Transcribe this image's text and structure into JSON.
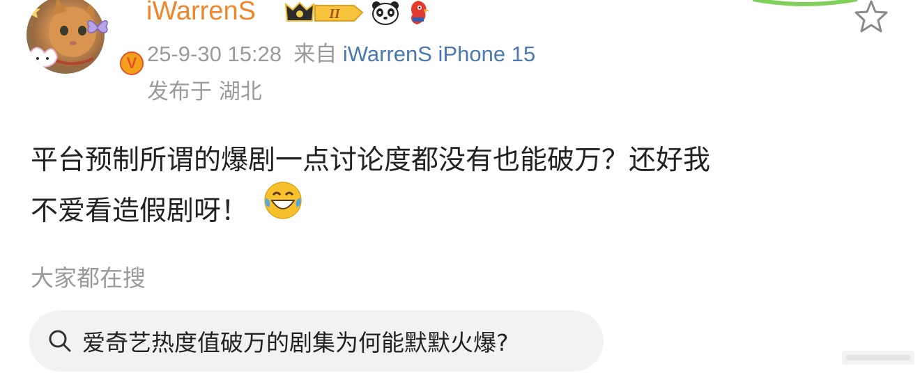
{
  "post": {
    "username": "iWarrenS",
    "timestamp": "25-9-30 15:28",
    "source_prefix": "来自",
    "source": "iWarrenS iPhone 15",
    "location": "发布于 湖北",
    "text_line1": "平台预制所谓的爆剧一点讨论度都没有也能破万？还好我",
    "text_line2": "不爱看造假剧呀！",
    "emoji": "laughing-with-tears",
    "verified_mark": "V"
  },
  "badges": [
    "crown-level-badge",
    "panda-icon",
    "red-mascot-icon"
  ],
  "badge_level_text": "II",
  "trending": {
    "title": "大家都在搜",
    "query": "爱奇艺热度值破万的剧集为何能默默火爆?"
  },
  "colors": {
    "username": "#f0862b",
    "source_link": "#4a78b0",
    "meta_gray": "#9a9a9a",
    "body_text": "#222222",
    "pill_bg": "#f2f2f2",
    "verified": "#f3a11b"
  }
}
